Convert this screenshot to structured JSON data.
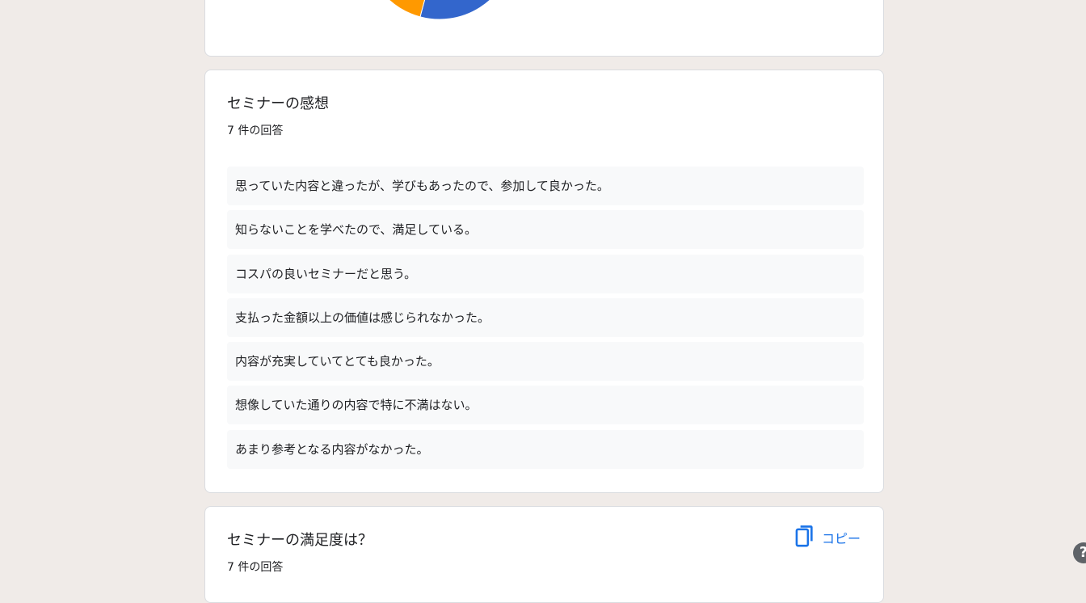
{
  "prev_question": {
    "chart_data": {
      "type": "pie",
      "visible_slices": [
        {
          "color": "#3366cc",
          "note": "partially visible"
        },
        {
          "color": "#ff9900",
          "note": "partially visible"
        }
      ]
    }
  },
  "impressions": {
    "title": "セミナーの感想",
    "count": "7 件の回答",
    "responses": [
      "思っていた内容と違ったが、学びもあったので、参加して良かった。",
      "知らないことを学べたので、満足している。",
      "コスパの良いセミナーだと思う。",
      "支払った金額以上の価値は感じられなかった。",
      "内容が充実していてとても良かった。",
      "想像していた通りの内容で特に不満はない。",
      "あまり参考となる内容がなかった。"
    ]
  },
  "satisfaction": {
    "title": "セミナーの満足度は？",
    "count": "7 件の回答",
    "copy_label": "コピー",
    "copy_icon": "copy-icon"
  },
  "help": {
    "icon": "help-icon",
    "glyph": "?"
  },
  "colors": {
    "accent": "#1a73e8",
    "background": "#f0ebe8",
    "pie_blue": "#3366cc",
    "pie_orange": "#ff9900"
  }
}
